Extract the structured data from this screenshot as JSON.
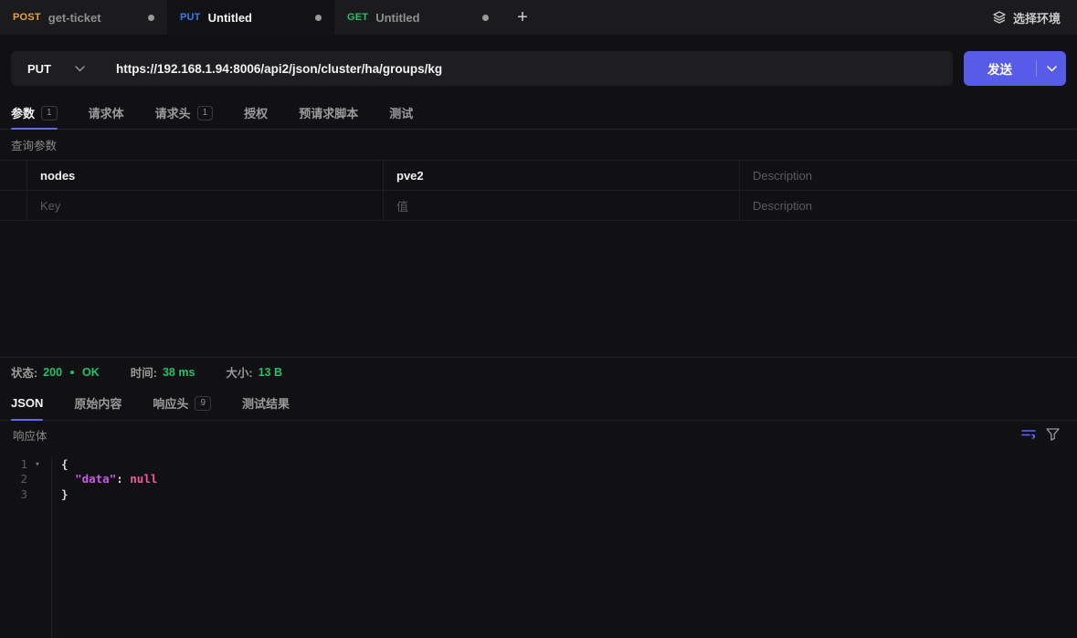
{
  "colors": {
    "accent": "#575ce8",
    "tab_underline": "#6467ef",
    "method_post": "#e6a23c",
    "method_put": "#2d7ff0",
    "method_get": "#23c16b",
    "status_green": "#23c16b",
    "json_key": "#c75ae8",
    "json_null": "#ed5a9f"
  },
  "icons": {
    "new_tab": "+",
    "fold_caret": "▾",
    "env": "layers-icon",
    "chevron": "chevron-down-icon",
    "format": "format-lines-icon",
    "filter": "filter-funnel-icon"
  },
  "tabbar": {
    "tabs": [
      {
        "method": "POST",
        "title": "get-ticket",
        "active": false
      },
      {
        "method": "PUT",
        "title": "Untitled",
        "active": true
      },
      {
        "method": "GET",
        "title": "Untitled",
        "active": false
      }
    ],
    "env_label": "选择环境"
  },
  "request": {
    "method": "PUT",
    "url": "https://192.168.1.94:8006/api2/json/cluster/ha/groups/kg",
    "send_label": "发送"
  },
  "request_tabs": [
    {
      "label": "参数",
      "badge": "1",
      "active": true
    },
    {
      "label": "请求体",
      "badge": "",
      "active": false
    },
    {
      "label": "请求头",
      "badge": "1",
      "active": false
    },
    {
      "label": "授权",
      "badge": "",
      "active": false
    },
    {
      "label": "预请求脚本",
      "badge": "",
      "active": false
    },
    {
      "label": "测试",
      "badge": "",
      "active": false
    }
  ],
  "params": {
    "section_label": "查询参数",
    "rows": [
      {
        "key": "nodes",
        "value": "pve2",
        "desc_placeholder": "Description"
      },
      {
        "key_placeholder": "Key",
        "value_placeholder": "值",
        "desc_placeholder": "Description"
      }
    ]
  },
  "response": {
    "status_label": "状态:",
    "status_code": "200",
    "status_text": "OK",
    "time_label": "时间:",
    "time_value": "38 ms",
    "size_label": "大小:",
    "size_value": "13 B",
    "tabs": [
      {
        "label": "JSON",
        "badge": "",
        "active": true
      },
      {
        "label": "原始内容",
        "badge": "",
        "active": false
      },
      {
        "label": "响应头",
        "badge": "9",
        "active": false
      },
      {
        "label": "测试结果",
        "badge": "",
        "active": false
      }
    ],
    "body_label": "响应体",
    "code": {
      "line_numbers": [
        "1",
        "2",
        "3"
      ],
      "line1": "{",
      "line2_key": "\"data\"",
      "line2_sep": ": ",
      "line2_value": "null",
      "line3": "}"
    }
  }
}
